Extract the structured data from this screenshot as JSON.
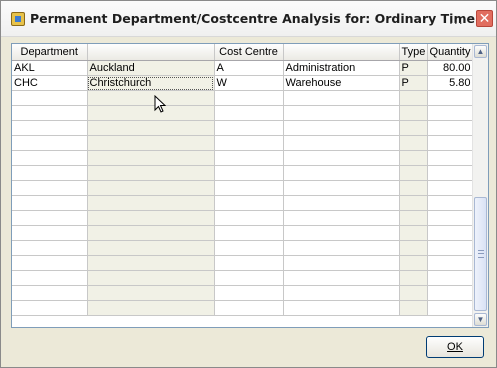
{
  "window": {
    "title": "Permanent Department/Costcentre Analysis for: Ordinary Time",
    "more": "...",
    "close": "✕"
  },
  "grid": {
    "headers": [
      "Department",
      "",
      "Cost Centre",
      "",
      "Type",
      "Quantity"
    ],
    "rows": [
      {
        "department_code": "AKL",
        "department_name": "Auckland",
        "costcentre_code": "A",
        "costcentre_name": "Administration",
        "type": "P",
        "quantity": "80.00"
      },
      {
        "department_code": "CHC",
        "department_name": "Christchurch",
        "costcentre_code": "W",
        "costcentre_name": "Warehouse",
        "type": "P",
        "quantity": "5.80"
      }
    ],
    "empty_rows": 15
  },
  "scrollbar": {
    "up_icon": "▲",
    "down_icon": "▼"
  },
  "footer": {
    "ok_label": "OK"
  },
  "colors": {
    "shaded_column": "#f1f1e6",
    "title_text": "#1e1e1e",
    "close_button": "#e16d5f"
  }
}
